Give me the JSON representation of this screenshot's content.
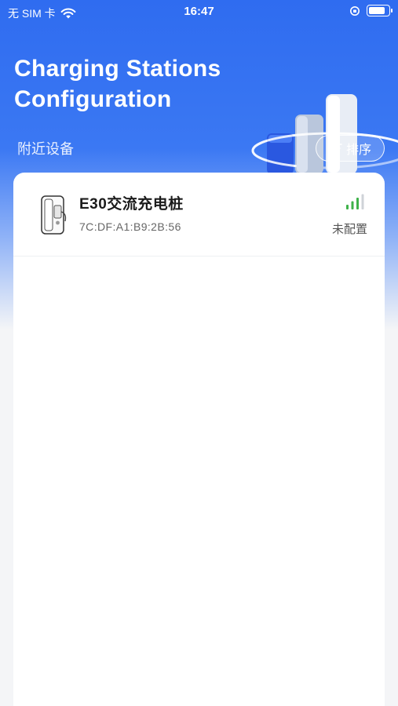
{
  "status_bar": {
    "carrier": "无 SIM 卡",
    "time": "16:47"
  },
  "header": {
    "title_line1": "Charging Stations",
    "title_line2": "Configuration",
    "section_label": "附近设备",
    "sort_label": "排序"
  },
  "devices": [
    {
      "name": "E30交流充电桩",
      "mac": "7C:DF:A1:B9:2B:56",
      "status": "未配置",
      "signal_bars_active": 3,
      "signal_bars_total": 4
    }
  ],
  "colors": {
    "primary": "#2f6cf0",
    "signal_active": "#3fb24a",
    "signal_inactive": "#cfd3d8"
  }
}
